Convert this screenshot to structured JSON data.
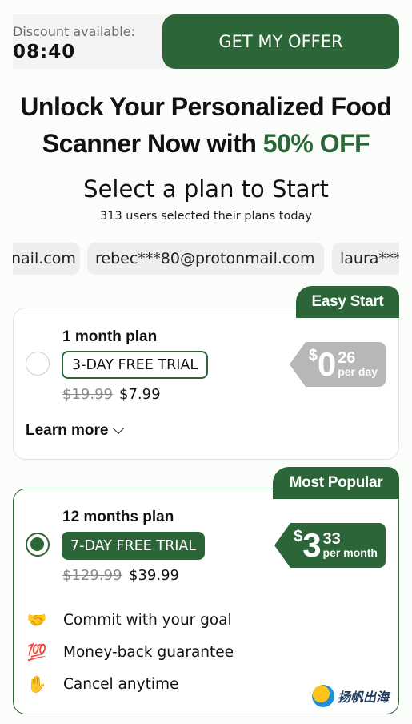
{
  "header": {
    "discount_label": "Discount available:",
    "timer": "08:40",
    "offer_button": "GET MY OFFER"
  },
  "headline": {
    "line1": "Unlock Your Personalized Food",
    "line2_prefix": "Scanner Now with ",
    "line2_highlight": "50% OFF"
  },
  "subheading": "Select a plan to Start",
  "users_note": "313 users selected their plans today",
  "emails": [
    "nail.com",
    "rebec***80@protonmail.com",
    "laura***"
  ],
  "plans": [
    {
      "badge": "Easy Start",
      "name": "1 month plan",
      "trial": "3-DAY FREE TRIAL",
      "old_price": "$19.99",
      "new_price": "$7.99",
      "per_currency": "$",
      "per_whole": "0",
      "per_cents": "26",
      "per_unit": "per day",
      "selected": false,
      "learn_more": "Learn more"
    },
    {
      "badge": "Most Popular",
      "name": "12 months plan",
      "trial": "7-DAY FREE TRIAL",
      "old_price": "$129.99",
      "new_price": "$39.99",
      "per_currency": "$",
      "per_whole": "3",
      "per_cents": "33",
      "per_unit": "per month",
      "selected": true
    }
  ],
  "features": [
    {
      "icon": "handshake-icon",
      "text": "Commit with your goal"
    },
    {
      "icon": "hundred-points-icon",
      "text": "Money-back guarantee"
    },
    {
      "icon": "raised-hand-icon",
      "text": "Cancel anytime"
    }
  ],
  "watermark": "扬帆出海",
  "colors": {
    "brand_green": "#2c6638",
    "grey_tag": "#b7b7b7",
    "background": "#fbfdfb"
  }
}
